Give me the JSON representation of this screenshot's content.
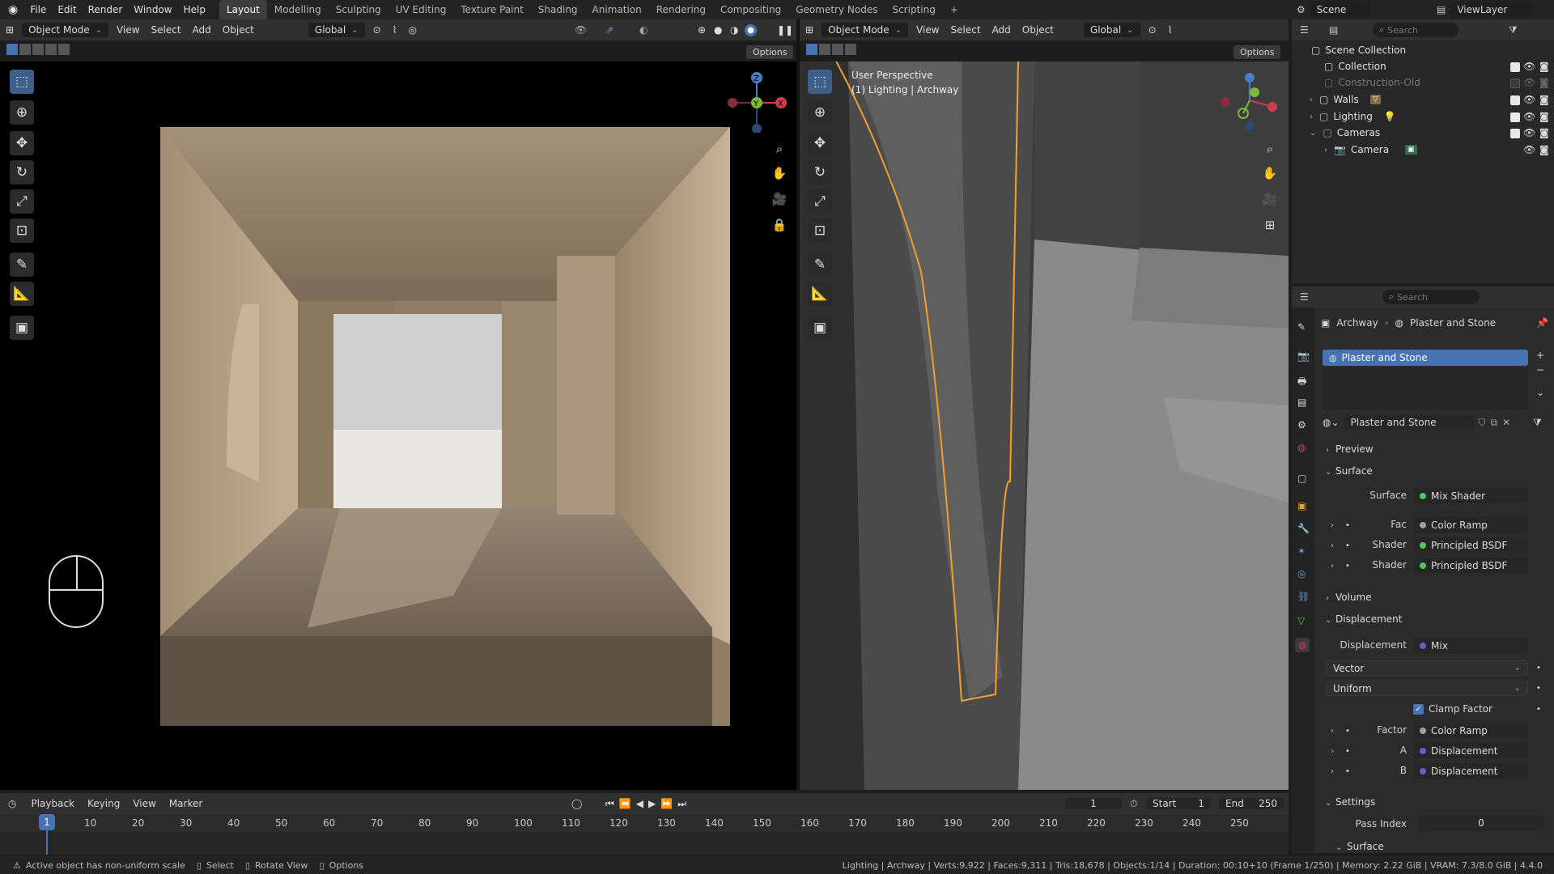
{
  "menus": [
    "File",
    "Edit",
    "Render",
    "Window",
    "Help"
  ],
  "workspaces": [
    "Layout",
    "Modelling",
    "Sculpting",
    "UV Editing",
    "Texture Paint",
    "Shading",
    "Animation",
    "Rendering",
    "Compositing",
    "Geometry Nodes",
    "Scripting"
  ],
  "active_workspace": "Layout",
  "scene": "Scene",
  "view_layer": "ViewLayer",
  "left_viewport": {
    "mode": "Object Mode",
    "menus": [
      "View",
      "Select",
      "Add",
      "Object"
    ],
    "orientation": "Global",
    "options": "Options"
  },
  "right_viewport": {
    "mode": "Object Mode",
    "menus": [
      "View",
      "Select",
      "Add",
      "Object"
    ],
    "orientation": "Global",
    "options": "Options",
    "view_name": "User Perspective",
    "view_sub": "(1) Lighting | Archway"
  },
  "outliner": {
    "search_placeholder": "Search",
    "items": [
      {
        "label": "Scene Collection"
      },
      {
        "label": "Collection"
      },
      {
        "label": "Construction-Old"
      },
      {
        "label": "Walls"
      },
      {
        "label": "Lighting"
      },
      {
        "label": "Cameras"
      },
      {
        "label": "Camera"
      }
    ]
  },
  "properties": {
    "search_placeholder": "Search",
    "breadcrumb_obj": "Archway",
    "breadcrumb_mat": "Plaster and Stone",
    "slot": "Plaster and Stone",
    "material": "Plaster and Stone",
    "sections": {
      "preview": "Preview",
      "surface": "Surface",
      "volume": "Volume",
      "displacement": "Displacement",
      "settings": "Settings",
      "surface2": "Surface"
    },
    "surface": {
      "label": "Surface",
      "value": "Mix Shader"
    },
    "fac": {
      "label": "Fac",
      "value": "Color Ramp"
    },
    "shader1": {
      "label": "Shader",
      "value": "Principled BSDF"
    },
    "shader2": {
      "label": "Shader",
      "value": "Principled BSDF"
    },
    "disp": {
      "label": "Displacement",
      "value": "Mix"
    },
    "vector": "Vector",
    "uniform": "Uniform",
    "clamp": "Clamp Factor",
    "factor": {
      "label": "Factor",
      "value": "Color Ramp"
    },
    "a": {
      "label": "A",
      "value": "Displacement"
    },
    "b": {
      "label": "B",
      "value": "Displacement"
    },
    "pass_index": {
      "label": "Pass Index",
      "value": "0"
    }
  },
  "timeline": {
    "menus": [
      "Playback",
      "Keying",
      "View",
      "Marker"
    ],
    "current": "1",
    "start_label": "Start",
    "start": "1",
    "end_label": "End",
    "end": "250",
    "ticks": [
      "10",
      "20",
      "30",
      "40",
      "50",
      "60",
      "70",
      "80",
      "90",
      "100",
      "110",
      "120",
      "130",
      "140",
      "150",
      "160",
      "170",
      "180",
      "190",
      "200",
      "210",
      "220",
      "230",
      "240",
      "250"
    ],
    "cursor_label": "1"
  },
  "status": {
    "left": [
      "Active object has non-uniform scale",
      "Select",
      "Rotate View",
      "Options"
    ],
    "right": "Lighting | Archway | Verts:9,922 | Faces:9,311 | Tris:18,678 | Objects:1/14 | Duration: 00:10+10 (Frame 1/250) | Memory: 2.22 GiB | VRAM: 7.3/8.0 GiB | 4.4.0"
  },
  "colors": {
    "accent": "#4772b3",
    "selection": "#f0a030",
    "bg": "#1d1d1d"
  }
}
